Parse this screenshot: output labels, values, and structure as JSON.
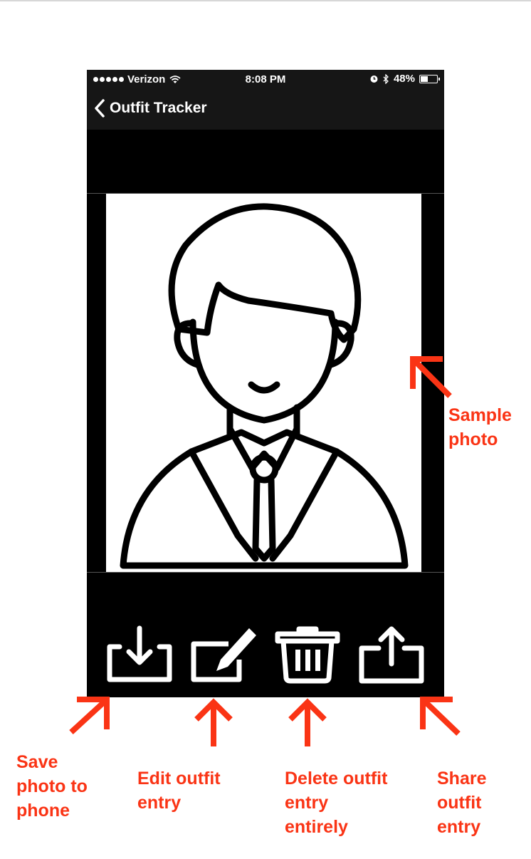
{
  "status_bar": {
    "carrier": "Verizon",
    "time": "8:08 PM",
    "battery": "48%",
    "battery_level": 0.48
  },
  "nav_bar": {
    "title": "Outfit Tracker"
  },
  "toolbar": {
    "buttons": [
      "download-icon",
      "edit-icon",
      "trash-icon",
      "share-icon"
    ]
  },
  "annotations": {
    "sample_photo": "Sample\nphoto",
    "save_photo": "Save\nphoto to\nphone",
    "edit_entry": "Edit outfit\nentry",
    "delete_entry": "Delete outfit\nentry\nentirely",
    "share_entry": "Share\noutfit\nentry"
  },
  "colors": {
    "annotation": "#fa3415",
    "bar": "#161616",
    "screen": "#000000"
  }
}
